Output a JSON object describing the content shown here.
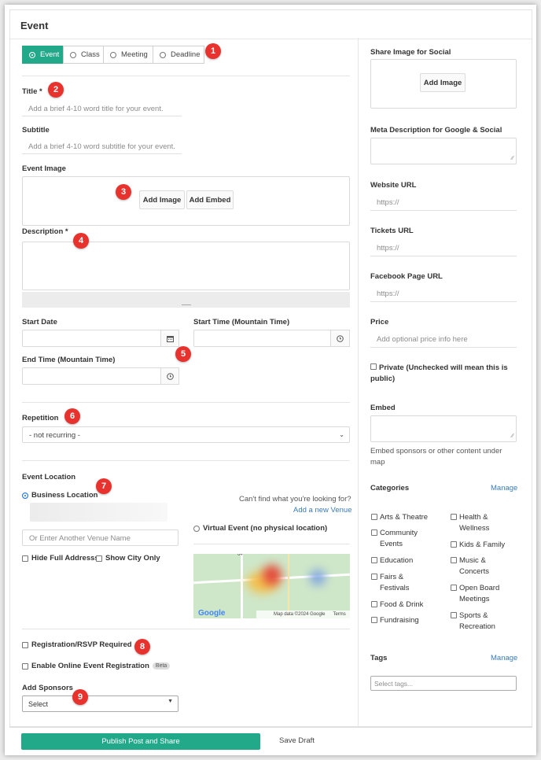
{
  "card": {
    "title": "Event"
  },
  "type_tabs": [
    "Event",
    "Class",
    "Meeting",
    "Deadline"
  ],
  "left": {
    "title_label": "Title *",
    "title_placeholder": "Add a brief 4-10 word title for your event.",
    "subtitle_label": "Subtitle",
    "subtitle_placeholder": "Add a brief 4-10 word subtitle for your event.",
    "event_image_label": "Event Image",
    "add_image": "Add Image",
    "add_embed": "Add Embed",
    "description_label": "Description *",
    "start_date_label": "Start Date",
    "start_time_label": "Start Time (Mountain Time)",
    "end_time_label": "End Time (Mountain Time)",
    "repetition_label": "Repetition",
    "repetition_value": "- not recurring -",
    "location_label": "Event Location",
    "business_location": "Business Location",
    "cant_find": "Can't find what you're looking for?",
    "add_venue": "Add a new Venue",
    "venue_placeholder": "Or Enter Another Venue Name",
    "virtual_event": "Virtual Event (no physical location)",
    "hide_address": "Hide Full Addresss",
    "show_city": "Show City Only",
    "map_data": "Map data ©2024 Google",
    "map_terms": "Terms",
    "map_google": "Google",
    "map_road": "64",
    "registration": "Registration/RSVP Required",
    "online_registration": "Enable Online Event Registration",
    "beta": "Beta",
    "sponsors_label": "Add Sponsors",
    "sponsors_value": "Select"
  },
  "right": {
    "share_image_label": "Share Image for Social",
    "share_add_image": "Add Image",
    "meta_label": "Meta Description for Google & Social",
    "website_label": "Website URL",
    "website_placeholder": "https://",
    "tickets_label": "Tickets URL",
    "tickets_placeholder": "https://",
    "facebook_label": "Facebook Page URL",
    "facebook_placeholder": "https://",
    "price_label": "Price",
    "price_placeholder": "Add optional price info here",
    "private_label": "Private (Unchecked will mean this is public)",
    "embed_label": "Embed",
    "embed_help": "Embed sponsors or other content under map",
    "categories_label": "Categories",
    "categories_manage": "Manage",
    "categories_left": [
      "Arts & Theatre",
      "Community Events",
      "Education",
      "Fairs & Festivals",
      "Food & Drink",
      "Fundraising"
    ],
    "categories_right": [
      "Health & Wellness",
      "Kids & Family",
      "Music & Concerts",
      "Open Board Meetings",
      "Sports & Recreation"
    ],
    "tags_label": "Tags",
    "tags_manage": "Manage",
    "tags_placeholder": "Select tags..."
  },
  "badges": [
    "1",
    "2",
    "3",
    "4",
    "5",
    "6",
    "7",
    "8",
    "9"
  ],
  "footer": {
    "publish": "Publish Post and Share",
    "save_draft": "Save Draft"
  },
  "colors": {
    "accent": "#22a98a",
    "badge": "#e8322d",
    "link": "#3a7bbf"
  }
}
